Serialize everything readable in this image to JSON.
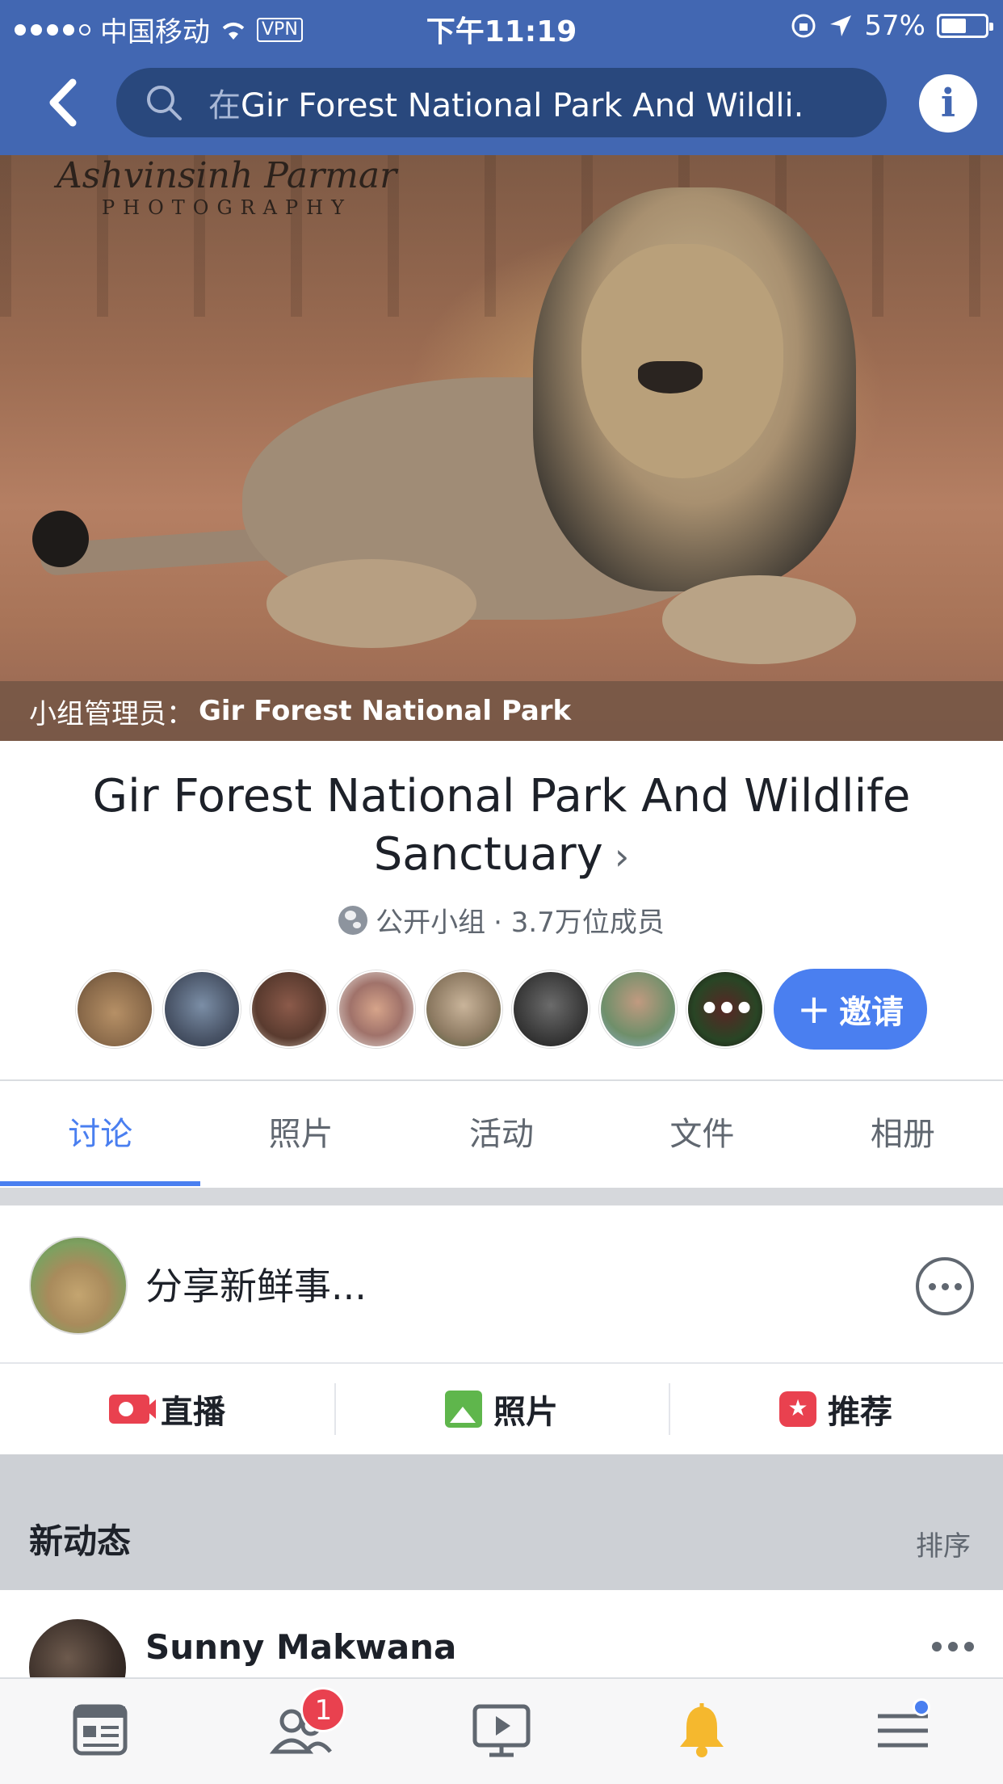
{
  "status_bar": {
    "carrier": "中国移动",
    "vpn": "VPN",
    "time": "下午11:19",
    "battery": "57%"
  },
  "nav": {
    "search_prefix": "在",
    "search_text": "Gir Forest National Park And Wildli..."
  },
  "cover": {
    "watermark_script": "Ashvinsinh Parmar",
    "watermark_sub": "PHOTOGRAPHY",
    "admin_label": "小组管理员：",
    "admin_name": "Gir Forest National Park"
  },
  "group": {
    "title": "Gir Forest National Park And Wildlife Sanctuary",
    "privacy": "公开小组",
    "members": "· 3.7万位成员",
    "invite_label": "邀请",
    "more_avatars": "•••"
  },
  "tabs": [
    {
      "label": "讨论",
      "active": true
    },
    {
      "label": "照片"
    },
    {
      "label": "活动"
    },
    {
      "label": "文件"
    },
    {
      "label": "相册"
    }
  ],
  "composer": {
    "prompt": "分享新鲜事...",
    "actions": [
      {
        "label": "直播",
        "icon": "live-video-icon"
      },
      {
        "label": "照片",
        "icon": "photo-icon"
      },
      {
        "label": "推荐",
        "icon": "recommend-icon"
      }
    ]
  },
  "feed": {
    "title": "新动态",
    "sort_label": "排序"
  },
  "post": {
    "author": "Sunny Makwana"
  },
  "bottom_tabs": {
    "friends_badge": "1"
  },
  "colors": {
    "brand": "#4267b2",
    "accent": "#4a7ff0",
    "badge": "#e9414f"
  }
}
